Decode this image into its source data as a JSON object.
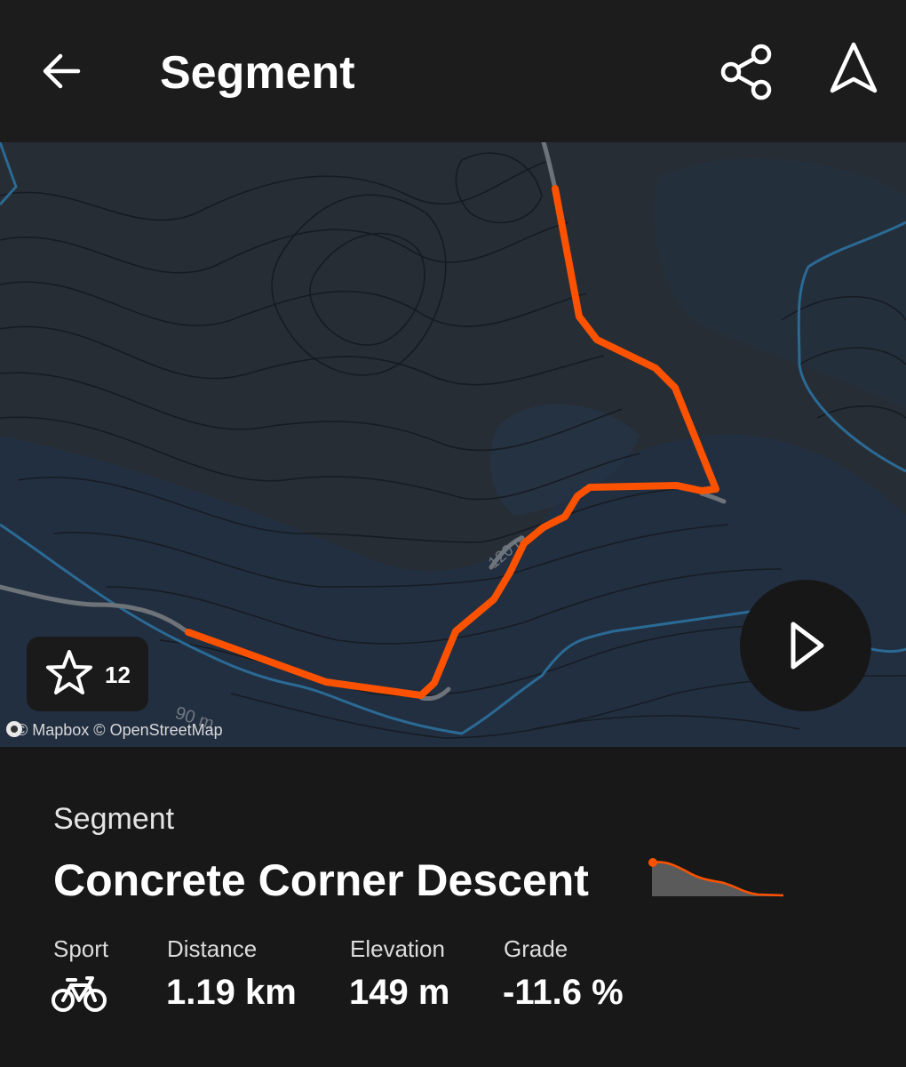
{
  "header": {
    "title": "Segment",
    "back_icon": "arrow-left-icon",
    "share_icon": "share-icon",
    "navigate_icon": "navigation-arrow-icon"
  },
  "map": {
    "attribution": "© Mapbox © OpenStreetMap",
    "contour_label_1": "90 m",
    "contour_label_2": "120 m",
    "star_count": "12",
    "route_color": "#fc5200",
    "play_icon": "play-icon"
  },
  "segment": {
    "label": "Segment",
    "name": "Concrete Corner Descent"
  },
  "stats": {
    "sport_label": "Sport",
    "sport_icon": "bicycle-icon",
    "distance_label": "Distance",
    "distance_value": "1.19 km",
    "elevation_label": "Elevation",
    "elevation_value": "149 m",
    "grade_label": "Grade",
    "grade_value": "-11.6 %"
  }
}
